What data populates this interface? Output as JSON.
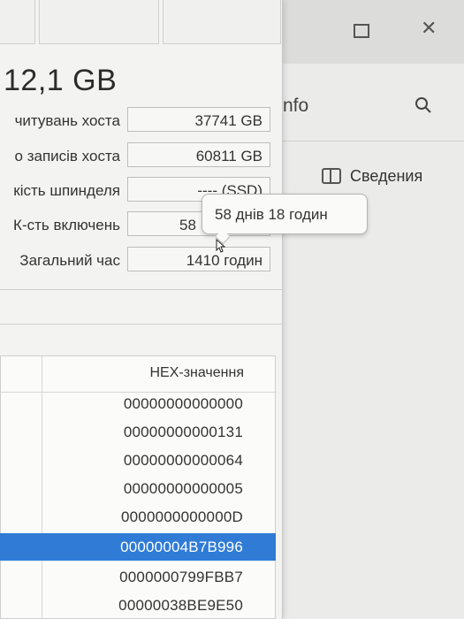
{
  "background_window": {
    "title_fragment": "nfo",
    "tab_label": "Сведения",
    "icons": [
      "maximize-icon",
      "close-icon",
      "search-icon",
      "panel-icon"
    ]
  },
  "main": {
    "capacity": "12,1 GB",
    "info_rows": [
      {
        "label": "читувань хоста",
        "value": "37741 GB"
      },
      {
        "label": "о записів хоста",
        "value": "60811 GB"
      },
      {
        "label": "кість шпинделя",
        "value": "---- (SSD)"
      },
      {
        "label": "К-сть включень",
        "value": "58"
      },
      {
        "label": "Загальний час",
        "value": "1410 годин"
      }
    ],
    "table": {
      "header": "HEX-значення",
      "rows": [
        "00000000000000",
        "00000000000131",
        "00000000000064",
        "00000000000005",
        "0000000000000D",
        "00000004B7B996",
        "0000000799FBB7",
        "00000038BE9E50"
      ],
      "selected_index": 5,
      "selection_color": "#2f7bd6"
    }
  },
  "tooltip": {
    "text": "58 днів 18 годин"
  }
}
